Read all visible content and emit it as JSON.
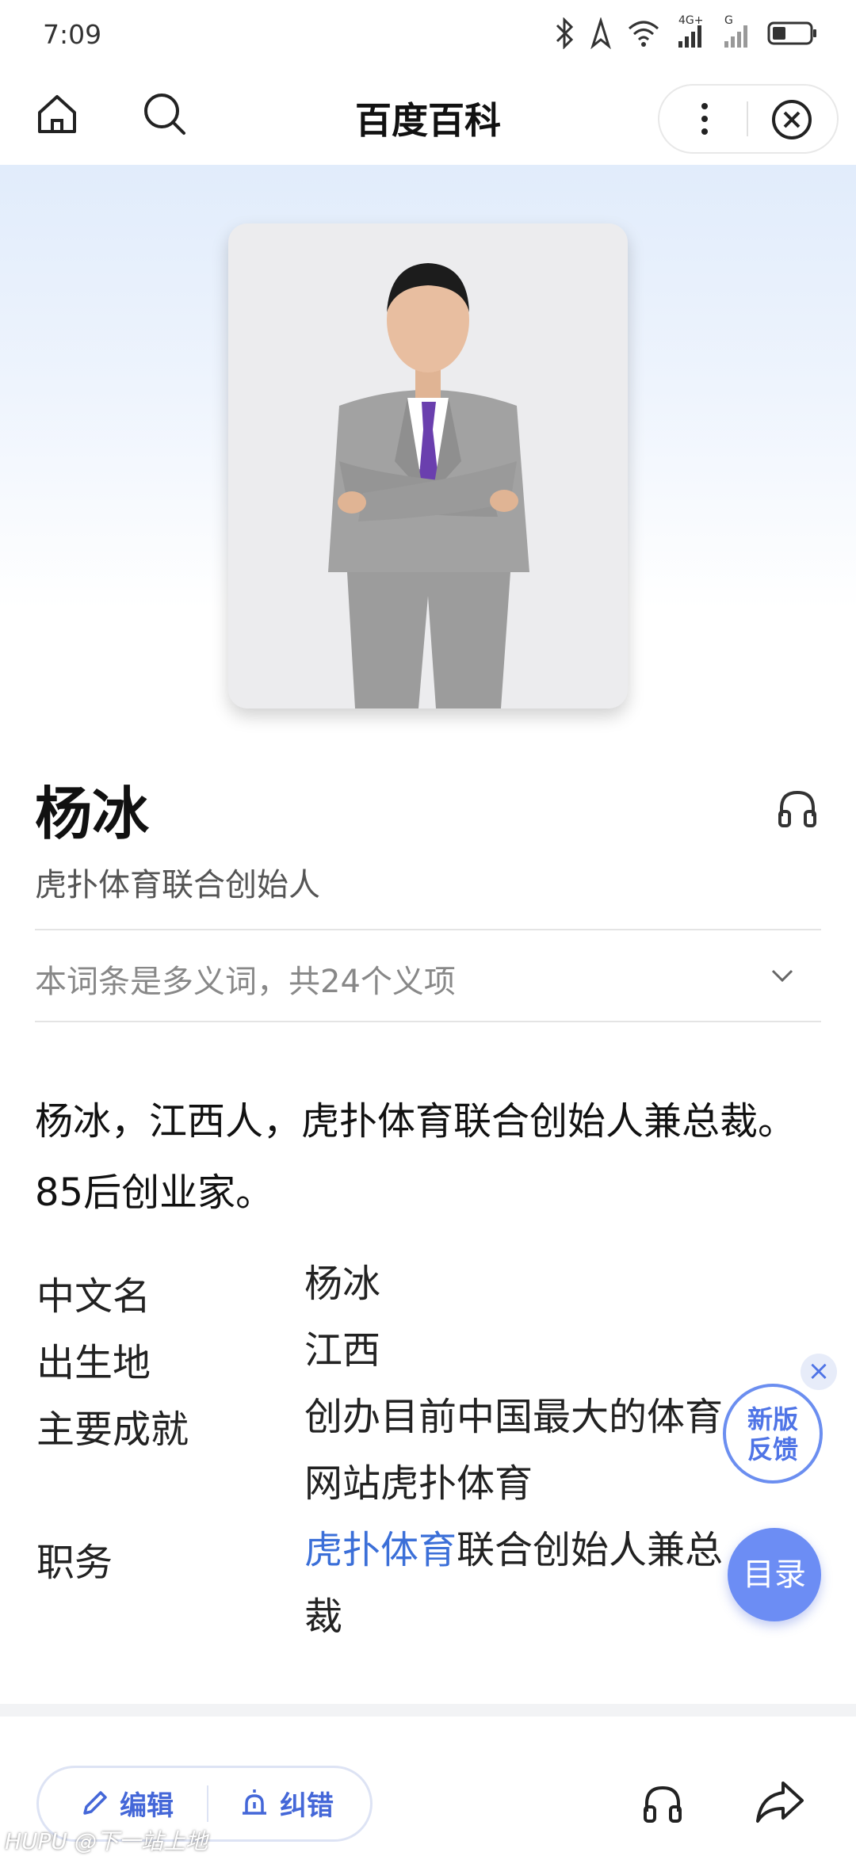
{
  "status": {
    "time": "7:09",
    "network_4g": "4G+",
    "network_g": "G"
  },
  "nav": {
    "title": "百度百科"
  },
  "entry": {
    "title": "杨冰",
    "subtitle": "虎扑体育联合创始人",
    "polysemy": "本词条是多义词，共24个义项",
    "intro": "杨冰，江西人，虎扑体育联合创始人兼总裁。85后创业家。"
  },
  "info": [
    {
      "key": "中文名",
      "value": "杨冰"
    },
    {
      "key": "出生地",
      "value": "江西"
    },
    {
      "key": "主要成就",
      "value": "创办目前中国最大的体育网站虎扑体育"
    },
    {
      "key": "职务",
      "link": "虎扑体育",
      "value": "联合创始人兼总裁"
    }
  ],
  "floating": {
    "feedback": "新版反馈",
    "feedback_line1": "新版",
    "feedback_line2": "反馈",
    "close": "×",
    "toc": "目录"
  },
  "bottom": {
    "edit": "编辑",
    "correct": "纠错"
  },
  "watermark": "HUPU @下一站上地",
  "colors": {
    "accent": "#4467d8",
    "link": "#3b6fd8",
    "toc_bg": "#6c8df4"
  }
}
